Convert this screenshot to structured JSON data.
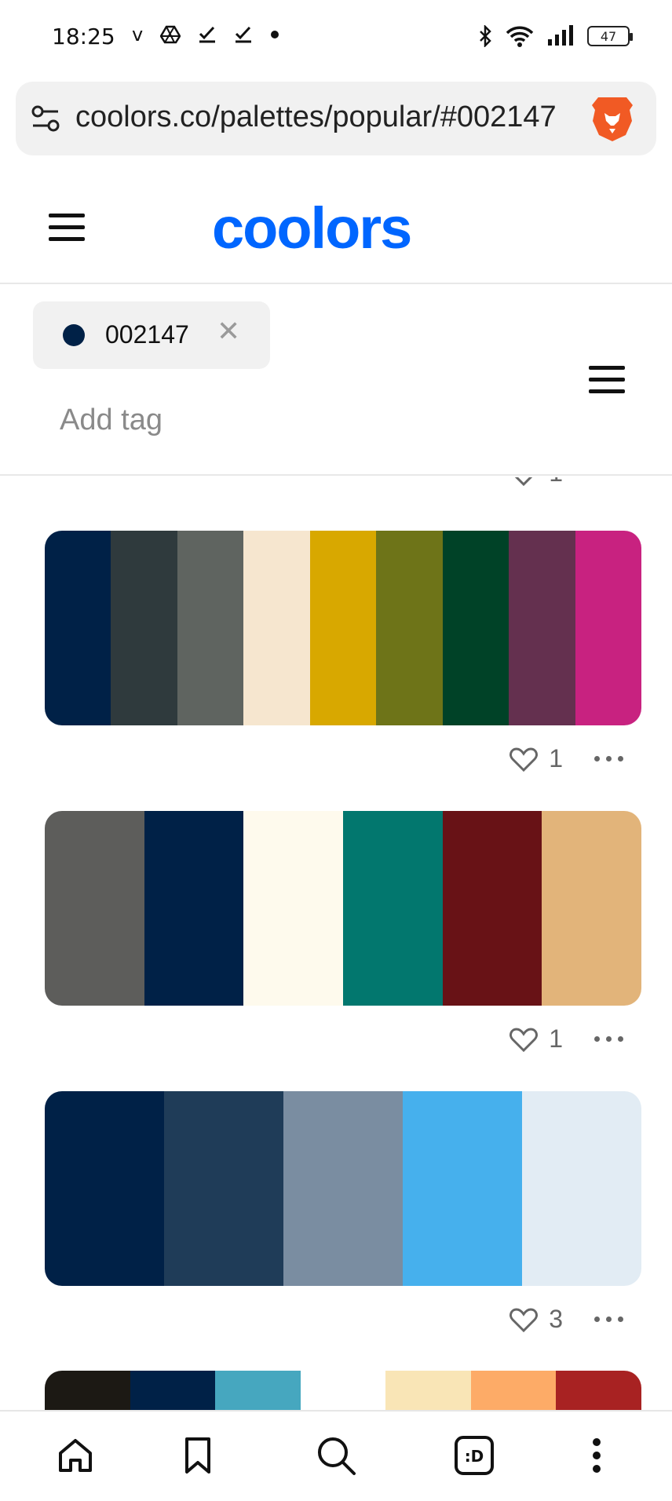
{
  "status_bar": {
    "time": "18:25",
    "left_icons": [
      "v",
      "drive-icon",
      "check-icon",
      "check-icon",
      "dot"
    ],
    "battery": "47"
  },
  "browser": {
    "url": "coolors.co/palettes/popular/#002147"
  },
  "header": {
    "logo": "coolors"
  },
  "filter": {
    "tag": {
      "label": "002147",
      "color": "#002147"
    },
    "add_tag_placeholder": "Add tag"
  },
  "feed": {
    "partial_like_count": "1",
    "palettes": [
      {
        "colors": [
          "#002147",
          "#2f3a3d",
          "#5f6460",
          "#f6e6cf",
          "#d8a800",
          "#6e7418",
          "#004227",
          "#64304f",
          "#c82280"
        ],
        "likes": "1"
      },
      {
        "colors": [
          "#5d5d5b",
          "#002147",
          "#fefaed",
          "#02776e",
          "#681216",
          "#e2b47a"
        ],
        "likes": "1"
      },
      {
        "colors": [
          "#002147",
          "#1f3c58",
          "#7a8da1",
          "#46b0ed",
          "#e2ecf4"
        ],
        "likes": "3"
      },
      {
        "colors": [
          "#1c1914",
          "#002147",
          "#46a7bf",
          "#ffffff",
          "#f9e5b6",
          "#fdab67",
          "#a82222"
        ]
      }
    ]
  },
  "colors": {
    "brand_blue": "#0066ff",
    "muted_text": "#8a8a8a"
  }
}
